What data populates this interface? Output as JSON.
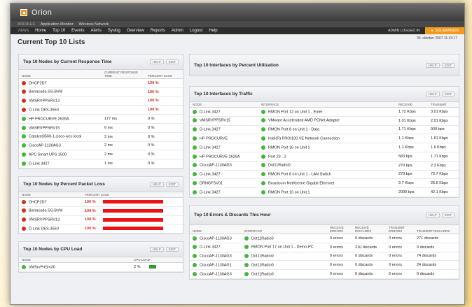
{
  "app": {
    "title": "Orion"
  },
  "modules": {
    "label": "MODULES",
    "items": [
      "Application Monitor",
      "Wireless Network"
    ]
  },
  "nav": {
    "label": "VIEWS",
    "items": [
      "Home",
      "Top 10",
      "Events",
      "Alerts",
      "Syslog",
      "Overview",
      "Reports",
      "Admin",
      "Logout",
      "Help"
    ],
    "admin_status": "ADMIN LOGGED IN",
    "brand": "SOLARWINDS"
  },
  "page": {
    "title": "Current Top 10 Lists",
    "datetime": "30. oktober 2007 11:33:17"
  },
  "panel_buttons": {
    "help": "HELP",
    "edit": "EDIT"
  },
  "response": {
    "title": "Top 10 Nodes by Current Response Time",
    "headers": [
      "NODE",
      "CURRENT RESPONSE TIME",
      "PERCENT LOSS"
    ],
    "rows": [
      {
        "status": "red",
        "node": "DHCP2D7",
        "time": "",
        "loss": "100 %"
      },
      {
        "status": "red",
        "node": "Barracuda-SS-BVM",
        "time": "",
        "loss": "100 %"
      },
      {
        "status": "red",
        "node": "VMSRVPPSRV13",
        "time": "",
        "loss": "100 %"
      },
      {
        "status": "red",
        "node": "D-Link DES-3550",
        "time": "",
        "loss": "100 %"
      },
      {
        "status": "green",
        "node": "HP PROCURVE 2626A",
        "time": "177 ms",
        "loss": "0 %"
      },
      {
        "status": "green",
        "node": "VMSRVPPSRV15",
        "time": "6 ms",
        "loss": "0 %"
      },
      {
        "status": "green",
        "node": "Catalyst3560-1.cisco-wcc.local",
        "time": "2 ms",
        "loss": "0 %"
      },
      {
        "status": "green",
        "node": "CiscoAP-1130AG3",
        "time": "2 ms",
        "loss": "0 %"
      },
      {
        "status": "green",
        "node": "APC Smart UPS 1500",
        "time": "2 ms",
        "loss": "0 %"
      },
      {
        "status": "green",
        "node": "D-Link 3427",
        "time": "1 ms",
        "loss": "0 %"
      }
    ]
  },
  "packet_loss": {
    "title": "Top 10 Nodes by Percent Packet Loss",
    "headers": [
      "NODE",
      "PERCENT LOSS"
    ],
    "rows": [
      {
        "node": "DHCP2D7",
        "loss": "100 %",
        "level": 1.0
      },
      {
        "node": "Barracuda-SS-BVM",
        "loss": "100 %",
        "level": 1.0
      },
      {
        "node": "VMSRVPPSRV13",
        "loss": "100 %",
        "level": 1.0
      },
      {
        "node": "D-Link DES-3550",
        "loss": "100 %",
        "level": 1.0
      }
    ]
  },
  "cpu": {
    "title": "Top 10 Nodes by CPU Load",
    "headers": [
      "NODE",
      "CPU LOAD"
    ],
    "rows": [
      {
        "node": "VMSrvPrtSrv30",
        "load": "2 %",
        "level": 0.02
      }
    ]
  },
  "utilization": {
    "title": "Top 10 Interfaces by Percent Utilization"
  },
  "traffic": {
    "title": "Top 10 Interfaces by Traffic",
    "headers": [
      "NODE",
      "INTERFACE",
      "RECEIVE",
      "TRANSMIT"
    ],
    "rows": [
      {
        "node": "D-Link 3427",
        "iface": "RMON Port 12 on Unit 1 - Enter",
        "rx": "1.72 Kbps",
        "tx": "3.01 Kbps"
      },
      {
        "node": "VMSRVPPSRV15",
        "iface": "VMware Accelerated AMD PCNet Adapter",
        "rx": "1.01 Kbps",
        "tx": "2.01 Kbps"
      },
      {
        "node": "D-Link 3427",
        "iface": "RMON Port 8 on Unit 1 - Data",
        "rx": "1.71 Kbps",
        "tx": "930 bps"
      },
      {
        "node": "HP PROCURVE",
        "iface": "Intel(R) PRO/100 VE Network Connection",
        "rx": "1.1 Kbps",
        "tx": "1.61 Kbps"
      },
      {
        "node": "D-Link 3427",
        "iface": "RMON Port 16 on Unit 1",
        "rx": "1.1 Kbps",
        "tx": "1.6 Kbps"
      },
      {
        "node": "HP PROCURVE 2626A",
        "iface": "Port 23 - 2",
        "rx": "583 bps",
        "tx": "1.71 Kbps"
      },
      {
        "node": "CiscoAP-1130AG3",
        "iface": "Dot11Radio0",
        "rx": "270 bps",
        "tx": "2.3 Kbps"
      },
      {
        "node": "D-Link 3427",
        "iface": "RMON Port 8 on Unit 1 - LAN Switch",
        "rx": "270 bps",
        "tx": "72.7 Kbps"
      },
      {
        "node": "DRNGFSV01",
        "iface": "Broadcom NetXtreme Gigabit Ethernet",
        "rx": "2.7 Kbps",
        "tx": "26.6 Kbps"
      },
      {
        "node": "D-Link 3427",
        "iface": "RMON Port 10 on Unit 1",
        "rx": "2000 bps",
        "tx": "42.1 Kbps"
      }
    ]
  },
  "errors": {
    "title": "Top 10 Errors & Discards This Hour",
    "headers": [
      "NODE",
      "INTERFACE",
      "RECEIVE ERRORS",
      "RECEIVE DISCARDS",
      "TRANSMIT ERRORS",
      "TRANSMIT DISCARDS"
    ],
    "rows": [
      {
        "node": "CiscoAP-1130AG3",
        "iface": "Dot11Radio0",
        "re": "0 errors",
        "rd": "0 discards",
        "te": "0 errors",
        "td": "271 discards"
      },
      {
        "node": "D-Link 3427",
        "iface": "RMON Port 17 on Unit 1 - Demo-PC",
        "re": "0 errors",
        "rd": "210 discards",
        "te": "0 errors",
        "td": "0 discards"
      },
      {
        "node": "CiscoAP-1130AG3",
        "iface": "Dot11Radio0",
        "re": "0 errors",
        "rd": "0 discards",
        "te": "0 errors",
        "td": "74 discards"
      },
      {
        "node": "CiscoAP-1130AG1",
        "iface": "Dot11Radio0",
        "re": "0 errors",
        "rd": "0 discards",
        "te": "0 errors",
        "td": "24 discards"
      },
      {
        "node": "CiscoAP-1130AG3",
        "iface": "Dot11Radio0",
        "re": "0 errors",
        "rd": "0 discards",
        "te": "0 errors",
        "td": "0 discards"
      }
    ]
  },
  "colors": {
    "accent": "#f39a1c",
    "up": "#43b53a",
    "down": "#d52b1e",
    "bar_red": "#ee1111",
    "bar_green": "#2e9e2e"
  }
}
